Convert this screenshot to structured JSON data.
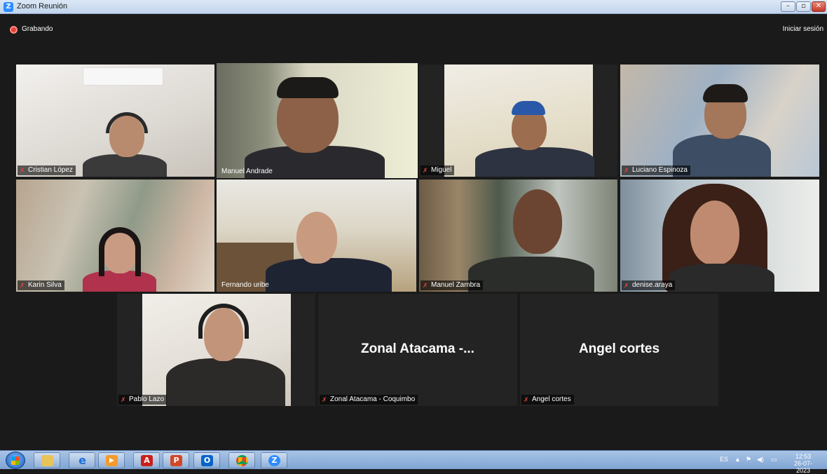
{
  "window": {
    "title": "Zoom Reunión",
    "buttons": {
      "minimize": "–",
      "maximize": "▫",
      "close": "✕"
    }
  },
  "meeting": {
    "recording_label": "Grabando",
    "signin_label": "Iniciar sesión",
    "participants": [
      {
        "name": "Cristian López",
        "muted": true
      },
      {
        "name": "Manuel Andrade",
        "muted": false,
        "active_speaker": true
      },
      {
        "name": "Miguel",
        "muted": true
      },
      {
        "name": "Luciano Espinoza",
        "muted": true
      },
      {
        "name": "Karin Silva",
        "muted": true
      },
      {
        "name": "Fernando uribe",
        "muted": false
      },
      {
        "name": "Manuel Zambra",
        "muted": true
      },
      {
        "name": "denise.araya",
        "muted": true
      },
      {
        "name": "Pablo Lazo",
        "muted": true
      },
      {
        "name": "Zonal Atacama - Coquimbo",
        "display_name": "Zonal  Atacama -...",
        "muted": true,
        "video_off": true
      },
      {
        "name": "Angel cortes",
        "display_name": "Angel cortes",
        "muted": true,
        "video_off": true
      }
    ]
  },
  "taskbar": {
    "apps": [
      {
        "name": "start-button",
        "icon": "windows-logo-icon"
      },
      {
        "name": "file-explorer",
        "icon": "folder-icon"
      },
      {
        "name": "internet-explorer",
        "icon": "ie-icon",
        "glyph": "e"
      },
      {
        "name": "media-player",
        "icon": "play-icon",
        "glyph": "▶"
      },
      {
        "name": "acrobat",
        "icon": "pdf-icon",
        "glyph": "A"
      },
      {
        "name": "powerpoint",
        "icon": "powerpoint-icon",
        "glyph": "P"
      },
      {
        "name": "outlook",
        "icon": "outlook-icon",
        "glyph": "O"
      },
      {
        "name": "chrome",
        "icon": "chrome-icon"
      },
      {
        "name": "zoom",
        "icon": "zoom-icon",
        "glyph": "Z"
      }
    ],
    "tray": {
      "language": "ES",
      "time": "12:53",
      "date": "26-07-2023"
    }
  },
  "colors": {
    "meeting_bg": "#1a1a1a",
    "active_speaker_border": "#c8e87a",
    "muted_icon": "#e0453a",
    "zoom_blue": "#2d8cff"
  }
}
